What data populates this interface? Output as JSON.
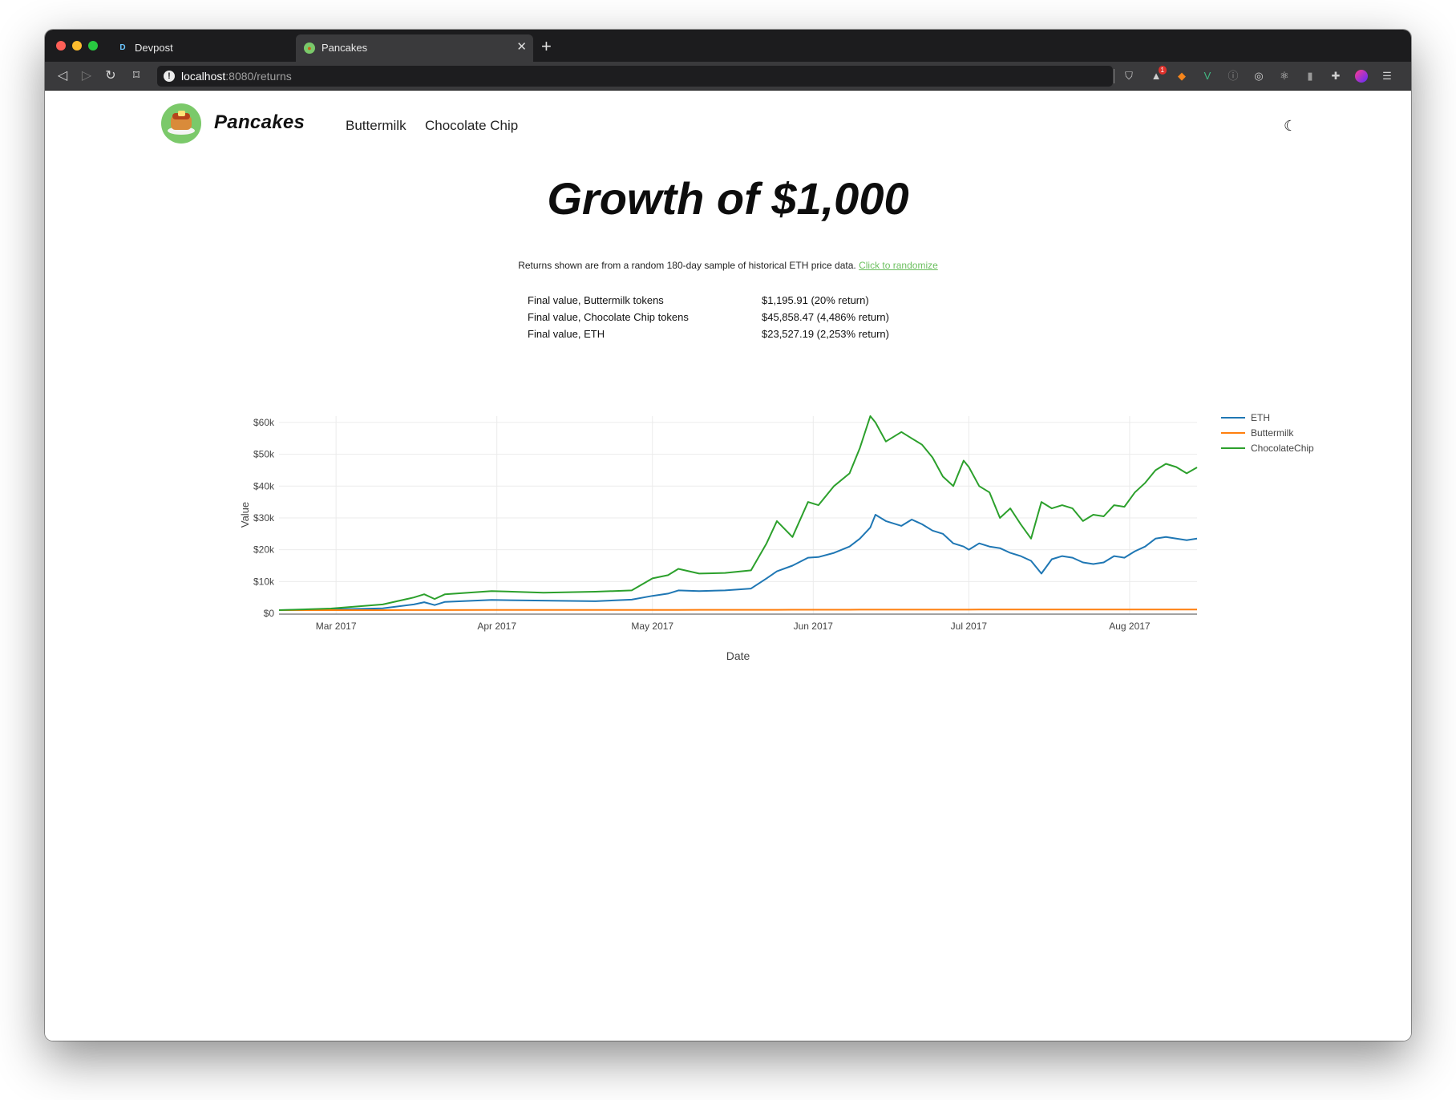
{
  "browser": {
    "tabs": [
      {
        "title": "Devpost",
        "favicon": "D"
      },
      {
        "title": "Pancakes",
        "favicon": "pancake-icon"
      }
    ],
    "url_host": "localhost",
    "url_path": ":8080/returns",
    "extension_badge": "1"
  },
  "nav": {
    "brand": "Pancakes",
    "links": [
      "Buttermilk",
      "Chocolate Chip"
    ]
  },
  "hero": {
    "title": "Growth of $1,000",
    "subtitle": "Returns shown are from a random 180-day sample of historical ETH price data.",
    "randomize_link": "Click to randomize"
  },
  "summary": [
    {
      "label": "Final value, Buttermilk tokens",
      "value": "$1,195.91 (20% return)"
    },
    {
      "label": "Final value, Chocolate Chip tokens",
      "value": "$45,858.47 (4,486% return)"
    },
    {
      "label": "Final value, ETH",
      "value": "$23,527.19 (2,253% return)"
    }
  ],
  "chart_data": {
    "type": "line",
    "title": "",
    "xlabel": "Date",
    "ylabel": "Value",
    "xlim": [
      "2017-02-18",
      "2017-08-14"
    ],
    "ylim": [
      0,
      62000
    ],
    "x_ticks": [
      {
        "date": "2017-03-01",
        "label": "Mar 2017"
      },
      {
        "date": "2017-04-01",
        "label": "Apr 2017"
      },
      {
        "date": "2017-05-01",
        "label": "May 2017"
      },
      {
        "date": "2017-06-01",
        "label": "Jun 2017"
      },
      {
        "date": "2017-07-01",
        "label": "Jul 2017"
      },
      {
        "date": "2017-08-01",
        "label": "Aug 2017"
      }
    ],
    "y_ticks": [
      {
        "value": 0,
        "label": "$0"
      },
      {
        "value": 10000,
        "label": "$10k"
      },
      {
        "value": 20000,
        "label": "$20k"
      },
      {
        "value": 30000,
        "label": "$30k"
      },
      {
        "value": 40000,
        "label": "$40k"
      },
      {
        "value": 50000,
        "label": "$50k"
      },
      {
        "value": 60000,
        "label": "$60k"
      }
    ],
    "grid": true,
    "legend_position": "right",
    "x": [
      "2017-02-18",
      "2017-02-28",
      "2017-03-10",
      "2017-03-16",
      "2017-03-18",
      "2017-03-20",
      "2017-03-22",
      "2017-03-31",
      "2017-04-10",
      "2017-04-20",
      "2017-04-27",
      "2017-05-01",
      "2017-05-04",
      "2017-05-06",
      "2017-05-10",
      "2017-05-15",
      "2017-05-20",
      "2017-05-23",
      "2017-05-25",
      "2017-05-28",
      "2017-05-31",
      "2017-06-02",
      "2017-06-05",
      "2017-06-08",
      "2017-06-10",
      "2017-06-12",
      "2017-06-13",
      "2017-06-15",
      "2017-06-18",
      "2017-06-20",
      "2017-06-22",
      "2017-06-24",
      "2017-06-26",
      "2017-06-28",
      "2017-06-30",
      "2017-07-01",
      "2017-07-03",
      "2017-07-05",
      "2017-07-07",
      "2017-07-09",
      "2017-07-11",
      "2017-07-13",
      "2017-07-15",
      "2017-07-17",
      "2017-07-19",
      "2017-07-21",
      "2017-07-23",
      "2017-07-25",
      "2017-07-27",
      "2017-07-29",
      "2017-07-31",
      "2017-08-02",
      "2017-08-04",
      "2017-08-06",
      "2017-08-08",
      "2017-08-10",
      "2017-08-12",
      "2017-08-14"
    ],
    "series": [
      {
        "name": "ETH",
        "color": "#1f77b4",
        "values": [
          1000,
          1200,
          1600,
          2800,
          3500,
          2600,
          3600,
          4200,
          4000,
          3800,
          4300,
          5500,
          6200,
          7200,
          7000,
          7200,
          7800,
          11000,
          13200,
          15000,
          17500,
          17700,
          19000,
          21000,
          23500,
          27000,
          31000,
          29000,
          27500,
          29500,
          28000,
          26000,
          25000,
          22000,
          21000,
          20000,
          22000,
          21000,
          20500,
          19000,
          18000,
          16500,
          12500,
          17000,
          18000,
          17500,
          16000,
          15500,
          16000,
          18000,
          17500,
          19500,
          21000,
          23500,
          24000,
          23500,
          23000,
          23500
        ]
      },
      {
        "name": "Buttermilk",
        "color": "#ff7f0e",
        "values": [
          1000,
          1010,
          1020,
          1030,
          1035,
          1040,
          1045,
          1050,
          1060,
          1070,
          1080,
          1085,
          1090,
          1095,
          1100,
          1105,
          1110,
          1115,
          1120,
          1125,
          1130,
          1135,
          1140,
          1145,
          1148,
          1150,
          1152,
          1155,
          1157,
          1160,
          1162,
          1164,
          1166,
          1168,
          1170,
          1171,
          1172,
          1174,
          1175,
          1176,
          1178,
          1179,
          1180,
          1181,
          1182,
          1183,
          1184,
          1185,
          1186,
          1187,
          1188,
          1190,
          1191,
          1192,
          1193,
          1194,
          1195,
          1196
        ]
      },
      {
        "name": "ChocolateChip",
        "color": "#2ca02c",
        "values": [
          1000,
          1500,
          2800,
          5000,
          6000,
          4500,
          6000,
          7000,
          6500,
          6800,
          7200,
          11000,
          12000,
          14000,
          12500,
          12700,
          13500,
          22000,
          29000,
          24000,
          35000,
          34000,
          40000,
          44000,
          52000,
          62000,
          60000,
          54000,
          57000,
          55000,
          53000,
          49000,
          43000,
          40000,
          48000,
          46000,
          40000,
          38000,
          30000,
          33000,
          28000,
          23500,
          35000,
          33000,
          34000,
          33000,
          29000,
          31000,
          30500,
          34000,
          33500,
          38000,
          41000,
          45000,
          47000,
          46000,
          44000,
          45858
        ]
      }
    ]
  }
}
